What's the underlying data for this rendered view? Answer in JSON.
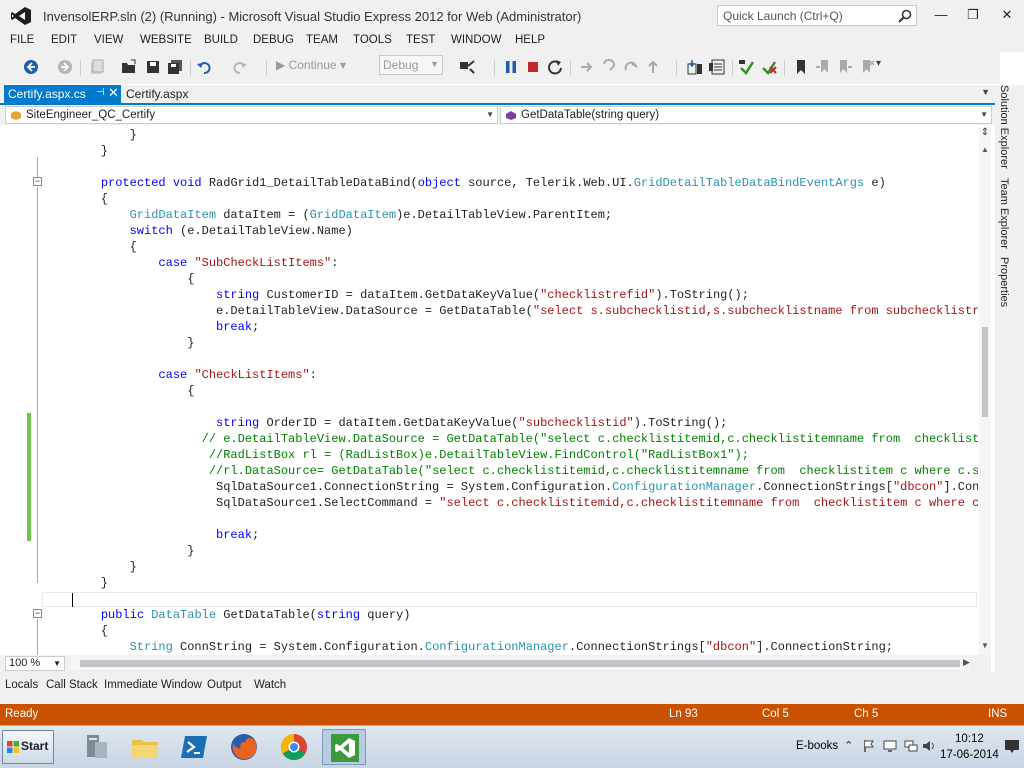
{
  "window": {
    "title": "InvensolERP.sln (2) (Running) - Microsoft Visual Studio Express 2012 for Web (Administrator)",
    "quick_launch_placeholder": "Quick Launch (Ctrl+Q)",
    "minimize_glyph": "—",
    "restore_glyph": "❐",
    "close_glyph": "✕"
  },
  "menu": [
    "FILE",
    "EDIT",
    "VIEW",
    "WEBSITE",
    "BUILD",
    "DEBUG",
    "TEAM",
    "TOOLS",
    "TEST",
    "WINDOW",
    "HELP"
  ],
  "toolbar": {
    "continue_label": "Continue",
    "config_value": "Debug"
  },
  "tabs": {
    "active": "Certify.aspx.cs",
    "second": "Certify.aspx"
  },
  "navbar": {
    "class_dropdown": "SiteEngineer_QC_Certify",
    "member_dropdown": "GetDataTable(string query)"
  },
  "code_lines": [
    [
      {
        "t": "        }",
        "c": ""
      }
    ],
    [
      {
        "t": "    }",
        "c": ""
      }
    ],
    [
      {
        "t": "",
        "c": ""
      }
    ],
    [
      {
        "t": "    ",
        "c": ""
      },
      {
        "t": "protected",
        "c": "k"
      },
      {
        "t": " ",
        "c": ""
      },
      {
        "t": "void",
        "c": "k"
      },
      {
        "t": " RadGrid1_DetailTableDataBind(",
        "c": ""
      },
      {
        "t": "object",
        "c": "k"
      },
      {
        "t": " source, Telerik.Web.UI.",
        "c": ""
      },
      {
        "t": "GridDetailTableDataBindEventArgs",
        "c": "t"
      },
      {
        "t": " e)",
        "c": ""
      }
    ],
    [
      {
        "t": "    {",
        "c": ""
      }
    ],
    [
      {
        "t": "        ",
        "c": ""
      },
      {
        "t": "GridDataItem",
        "c": "t"
      },
      {
        "t": " dataItem = (",
        "c": ""
      },
      {
        "t": "GridDataItem",
        "c": "t"
      },
      {
        "t": ")e.DetailTableView.ParentItem;",
        "c": ""
      }
    ],
    [
      {
        "t": "        ",
        "c": ""
      },
      {
        "t": "switch",
        "c": "k"
      },
      {
        "t": " (e.DetailTableView.Name)",
        "c": ""
      }
    ],
    [
      {
        "t": "        {",
        "c": ""
      }
    ],
    [
      {
        "t": "            ",
        "c": ""
      },
      {
        "t": "case",
        "c": "k"
      },
      {
        "t": " ",
        "c": ""
      },
      {
        "t": "\"SubCheckListItems\"",
        "c": "s"
      },
      {
        "t": ":",
        "c": ""
      }
    ],
    [
      {
        "t": "                {",
        "c": ""
      }
    ],
    [
      {
        "t": "                    ",
        "c": ""
      },
      {
        "t": "string",
        "c": "k"
      },
      {
        "t": " CustomerID = dataItem.GetDataKeyValue(",
        "c": ""
      },
      {
        "t": "\"checklistrefid\"",
        "c": "s"
      },
      {
        "t": ").ToString();",
        "c": ""
      }
    ],
    [
      {
        "t": "                    e.DetailTableView.DataSource = GetDataTable(",
        "c": ""
      },
      {
        "t": "\"select s.subchecklistid,s.subchecklistname from subchecklistref s  wh",
        "c": "s"
      }
    ],
    [
      {
        "t": "                    ",
        "c": ""
      },
      {
        "t": "break",
        "c": "k"
      },
      {
        "t": ";",
        "c": ""
      }
    ],
    [
      {
        "t": "                }",
        "c": ""
      }
    ],
    [
      {
        "t": "",
        "c": ""
      }
    ],
    [
      {
        "t": "            ",
        "c": ""
      },
      {
        "t": "case",
        "c": "k"
      },
      {
        "t": " ",
        "c": ""
      },
      {
        "t": "\"CheckListItems\"",
        "c": "s"
      },
      {
        "t": ":",
        "c": ""
      }
    ],
    [
      {
        "t": "                {",
        "c": ""
      }
    ],
    [
      {
        "t": "",
        "c": ""
      }
    ],
    [
      {
        "t": "                    ",
        "c": ""
      },
      {
        "t": "string",
        "c": "k"
      },
      {
        "t": " OrderID = dataItem.GetDataKeyValue(",
        "c": ""
      },
      {
        "t": "\"subchecklistid\"",
        "c": "s"
      },
      {
        "t": ").ToString();",
        "c": ""
      }
    ],
    [
      {
        "t": "                  ",
        "c": ""
      },
      {
        "t": "// e.DetailTableView.DataSource = GetDataTable(\"select c.checklistitemid,c.checklistitemname from  checklistitem c",
        "c": "c"
      }
    ],
    [
      {
        "t": "                   ",
        "c": ""
      },
      {
        "t": "//RadListBox rl = (RadListBox)e.DetailTableView.FindControl(\"RadListBox1\");",
        "c": "c"
      }
    ],
    [
      {
        "t": "                   ",
        "c": ""
      },
      {
        "t": "//rl.DataSource= GetDataTable(\"select c.checklistitemid,c.checklistitemname from  checklistitem c where c.subchec",
        "c": "c"
      }
    ],
    [
      {
        "t": "                    SqlDataSource1.ConnectionString = System.Configuration.",
        "c": ""
      },
      {
        "t": "ConfigurationManager",
        "c": "t"
      },
      {
        "t": ".ConnectionStrings[",
        "c": ""
      },
      {
        "t": "\"dbcon\"",
        "c": "s"
      },
      {
        "t": "].ConnectionS",
        "c": ""
      }
    ],
    [
      {
        "t": "                    SqlDataSource1.SelectCommand = ",
        "c": ""
      },
      {
        "t": "\"select c.checklistitemid,c.checklistitemname from  checklistitem c where c.subchec",
        "c": "s"
      }
    ],
    [
      {
        "t": "",
        "c": ""
      }
    ],
    [
      {
        "t": "                    ",
        "c": ""
      },
      {
        "t": "break",
        "c": "k"
      },
      {
        "t": ";",
        "c": ""
      }
    ],
    [
      {
        "t": "                }",
        "c": ""
      }
    ],
    [
      {
        "t": "        }",
        "c": ""
      }
    ],
    [
      {
        "t": "    }",
        "c": ""
      }
    ],
    [
      {
        "t": "",
        "c": ""
      }
    ],
    [
      {
        "t": "    ",
        "c": ""
      },
      {
        "t": "public",
        "c": "k"
      },
      {
        "t": " ",
        "c": ""
      },
      {
        "t": "DataTable",
        "c": "t"
      },
      {
        "t": " GetDataTable(",
        "c": ""
      },
      {
        "t": "string",
        "c": "k"
      },
      {
        "t": " query)",
        "c": ""
      }
    ],
    [
      {
        "t": "    {",
        "c": ""
      }
    ],
    [
      {
        "t": "        ",
        "c": ""
      },
      {
        "t": "String",
        "c": "t"
      },
      {
        "t": " ConnString = System.Configuration.",
        "c": ""
      },
      {
        "t": "ConfigurationManager",
        "c": "t"
      },
      {
        "t": ".ConnectionStrings[",
        "c": ""
      },
      {
        "t": "\"dbcon\"",
        "c": "s"
      },
      {
        "t": "].ConnectionString;",
        "c": ""
      }
    ]
  ],
  "zoom": "100 %",
  "side_tabs": [
    "Solution Explorer",
    "Team Explorer",
    "Properties"
  ],
  "tool_tabs": [
    "Locals",
    "Call Stack",
    "Immediate Window",
    "Output",
    "Watch"
  ],
  "status": {
    "message": "Ready",
    "line": "Ln 93",
    "col": "Col 5",
    "ch": "Ch 5",
    "mode": "INS"
  },
  "taskbar": {
    "start_label": "Start",
    "toolbar_label": "E-books",
    "time": "10:12",
    "date": "17-06-2014"
  },
  "colors": {
    "accent": "#007acc",
    "status_bar": "#ca5100",
    "keyword": "#0000ff",
    "type": "#2b91af",
    "string": "#a31515",
    "comment": "#008000"
  }
}
